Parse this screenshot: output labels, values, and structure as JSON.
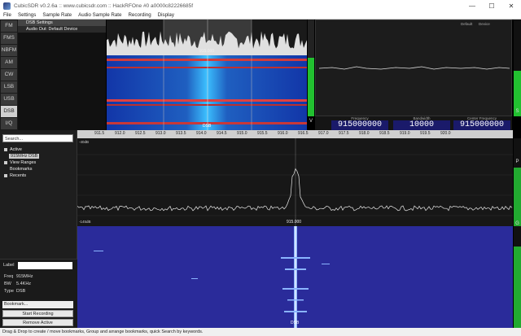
{
  "window": {
    "title": "CubicSDR v0.2.6a :: www.cubicsdr.com :: HackRFOne #0 a0000c82226685f",
    "minimize": "—",
    "maximize": "☐",
    "close": "✕"
  },
  "menu": [
    "File",
    "Settings",
    "Sample Rate",
    "Audio Sample Rate",
    "Recording",
    "Display"
  ],
  "modes": [
    {
      "label": "FM",
      "active": false
    },
    {
      "label": "FMS",
      "active": false
    },
    {
      "label": "NBFM",
      "active": false
    },
    {
      "label": "AM",
      "active": false
    },
    {
      "label": "CW",
      "active": false
    },
    {
      "label": "LSB",
      "active": false
    },
    {
      "label": "USB",
      "active": false
    },
    {
      "label": "DSB",
      "active": true
    },
    {
      "label": "I/Q",
      "active": false
    }
  ],
  "settings_panel": {
    "row1": "DSB Settings",
    "row2": "Audio Out: Default Device"
  },
  "top_spectrum": {
    "center_label": "915.000",
    "bottom_label": "DSB"
  },
  "scope": {
    "tag_left": "Default",
    "tag_right": "Device"
  },
  "readouts": [
    {
      "label": "Frequency",
      "value": "915000000"
    },
    {
      "label": "Bandwidth",
      "value": "10000"
    },
    {
      "label": "Center Frequency",
      "value": "915000000"
    }
  ],
  "meter_side_labels": {
    "top_v": "V",
    "right_s": "S",
    "right_p": "P",
    "right_g": "G"
  },
  "ruler_ticks": [
    "911.5",
    "912.0",
    "912.5",
    "913.0",
    "913.5",
    "914.0",
    "914.5",
    "915.0",
    "915.5",
    "916.0",
    "916.5",
    "917.0",
    "917.5",
    "918.0",
    "918.5",
    "919.0",
    "919.5",
    "920.0"
  ],
  "ruler_ticks_left": [
    "911.0",
    "911.5",
    "912.0",
    "912.5",
    "913.0",
    "913.5",
    "914.0",
    "914.5",
    "915.0"
  ],
  "bookmarks": {
    "search_placeholder": "Search...",
    "tree": {
      "active": "Active",
      "active_child": "915MHz DSB",
      "view_ranges": "View Ranges",
      "bookmarks": "Bookmarks",
      "recents": "Recents"
    },
    "label_caption": "Label",
    "freq_key": "Freq",
    "freq_val": "915MHz",
    "bw_key": "BW",
    "bw_val": "5.4KHz",
    "type_key": "Type",
    "type_val": "DSB",
    "select_label": "Bookmark...",
    "start_recording": "Start Recording",
    "remove_active": "Remove Active"
  },
  "main_spectrum": {
    "level_top": "-40dB",
    "level_bottom": "-145dB",
    "center_label": "915.000"
  },
  "main_water": {
    "center_label": "DSB"
  },
  "status": "Drag & Drop to create / move bookmarks, Group and arrange bookmarks, quick Search by keywords."
}
